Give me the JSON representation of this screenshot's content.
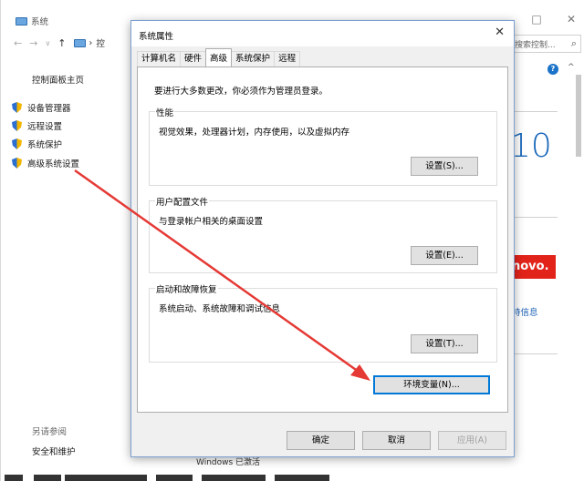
{
  "system_window": {
    "title": "系统",
    "caption_buttons": [
      "□",
      "✕"
    ],
    "breadcrumb": "控",
    "search_placeholder": "搜索控制...",
    "control_panel_home": "控制面板主页",
    "side_links": [
      "设备管理器",
      "远程设置",
      "系统保护",
      "高级系统设置"
    ],
    "see_also": "另请参阅",
    "security_link": "安全和维护",
    "windows_brand": "10",
    "oem_logo": "novo.",
    "info_link": "持信息",
    "bottom_text": "Windows 已激活"
  },
  "dialog": {
    "title": "系统属性",
    "close": "✕",
    "tabs": [
      {
        "label": "计算机名",
        "active": false
      },
      {
        "label": "硬件",
        "active": false
      },
      {
        "label": "高级",
        "active": true
      },
      {
        "label": "系统保护",
        "active": false
      },
      {
        "label": "远程",
        "active": false
      }
    ],
    "admin_note": "要进行大多数更改，你必须作为管理员登录。",
    "performance": {
      "label": "性能",
      "description": "视觉效果，处理器计划，内存使用，以及虚拟内存",
      "button": "设置(S)..."
    },
    "user_profiles": {
      "label": "用户配置文件",
      "description": "与登录帐户相关的桌面设置",
      "button": "设置(E)..."
    },
    "startup_recovery": {
      "label": "启动和故障恢复",
      "description": "系统启动、系统故障和调试信息",
      "button": "设置(T)..."
    },
    "env_button": "环境变量(N)...",
    "ok": "确定",
    "cancel": "取消",
    "apply": "应用(A)"
  },
  "colors": {
    "annotation_arrow": "#e53935",
    "dialog_border": "#7b9fcf",
    "default_button_border": "#0078d7",
    "windows_blue": "#1565b8",
    "oem_red": "#e2231a"
  }
}
